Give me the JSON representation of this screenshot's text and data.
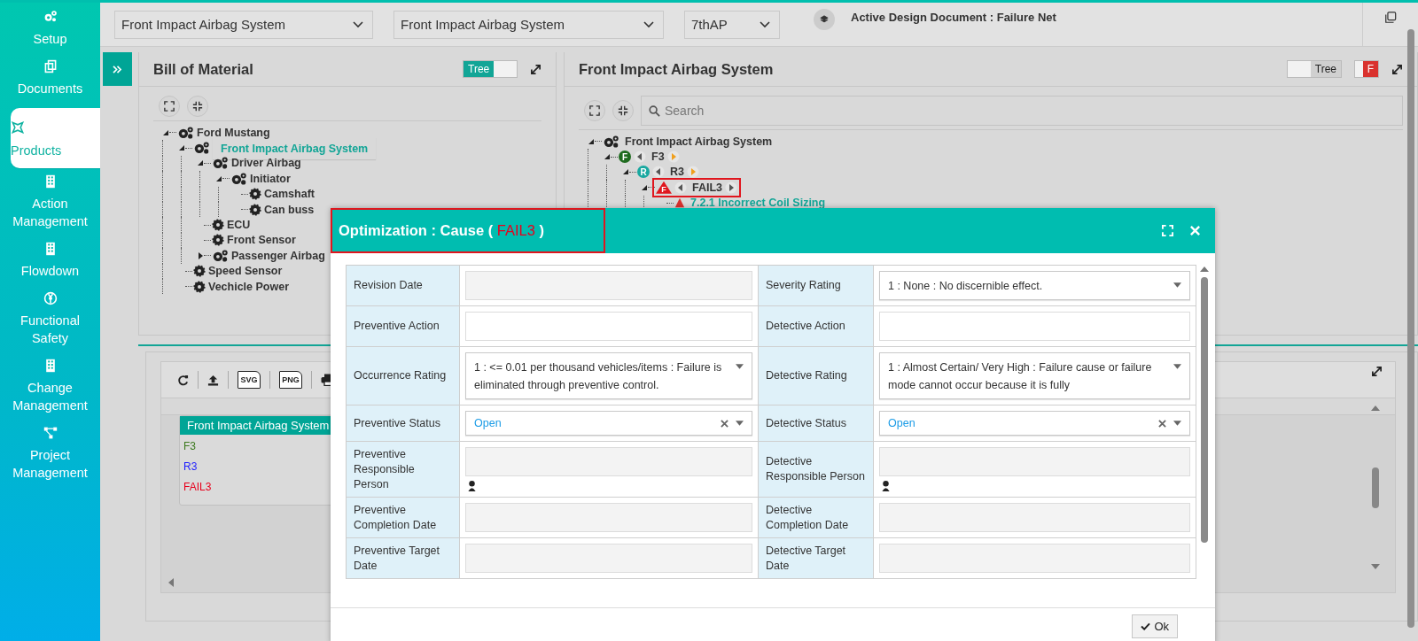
{
  "sidebar": {
    "items": [
      {
        "label": "Setup",
        "selected": false
      },
      {
        "label": "Documents",
        "selected": false
      },
      {
        "label": "Products",
        "selected": true
      },
      {
        "label": "Action Management",
        "selected": false
      },
      {
        "label": "Flowdown",
        "selected": false
      },
      {
        "label": "Functional Safety",
        "selected": false
      },
      {
        "label": "Change Management",
        "selected": false
      },
      {
        "label": "Project Management",
        "selected": false
      }
    ]
  },
  "topbar": {
    "selects": [
      "Front Impact Airbag System",
      "Front Impact Airbag System",
      "7thAP"
    ],
    "active_document": "Active Design Document : Failure Net"
  },
  "bom_panel": {
    "title": "Bill of Material",
    "toggle": {
      "label": "Tree",
      "on": true
    },
    "tree": [
      {
        "label": "Ford Mustang",
        "kind": "assembly",
        "expanded": true,
        "selected": false,
        "children": [
          {
            "label": "Front Impact Airbag System",
            "kind": "assembly",
            "expanded": true,
            "selected": true,
            "children": [
              {
                "label": "Driver Airbag",
                "kind": "assembly",
                "expanded": true,
                "selected": false,
                "children": [
                  {
                    "label": "Initiator",
                    "kind": "assembly",
                    "expanded": true,
                    "selected": false,
                    "children": [
                      {
                        "label": "Camshaft",
                        "kind": "part",
                        "selected": false
                      },
                      {
                        "label": "Can buss",
                        "kind": "part",
                        "selected": false
                      }
                    ]
                  }
                ]
              },
              {
                "label": "ECU",
                "kind": "part",
                "selected": false
              },
              {
                "label": "Front Sensor",
                "kind": "part",
                "selected": false
              },
              {
                "label": "Passenger Airbag",
                "kind": "assembly",
                "expanded": false,
                "selected": false
              }
            ]
          },
          {
            "label": "Speed Sensor",
            "kind": "part",
            "selected": false
          },
          {
            "label": "Vechicle Power",
            "kind": "part",
            "selected": false
          }
        ]
      }
    ]
  },
  "structure_panel": {
    "title": "Front Impact Airbag System",
    "tree_toggle": {
      "label": "Tree",
      "on": false
    },
    "flag_toggle": {
      "label": "F",
      "on": true
    },
    "search": {
      "placeholder": "Search"
    },
    "tree": [
      {
        "label": "Front Impact Airbag System",
        "kind": "assembly",
        "expanded": true,
        "children": [
          {
            "label": "F3",
            "kind": "function",
            "badge": "F",
            "expanded": true,
            "next_available": true,
            "children": [
              {
                "label": "R3",
                "kind": "requirement",
                "badge": "R",
                "expanded": true,
                "next_available": true,
                "children": [
                  {
                    "label": "FAIL3",
                    "kind": "failure",
                    "badge": "F",
                    "expanded": true,
                    "next_available": false,
                    "highlighted": true,
                    "children": [
                      {
                        "label": "7.2.1 Incorrect Coil Sizing",
                        "kind": "cause"
                      }
                    ]
                  }
                ]
              }
            ]
          }
        ]
      }
    ]
  },
  "report_panel": {
    "toolbar": [
      {
        "kind": "refresh"
      },
      {
        "kind": "upload"
      },
      {
        "kind": "file",
        "label": "SVG"
      },
      {
        "kind": "file",
        "label": "PNG"
      },
      {
        "kind": "print"
      }
    ],
    "card": {
      "title": "Front Impact Airbag System",
      "rows": [
        {
          "label": "F3",
          "color": "#3d7a1f"
        },
        {
          "label": "R3",
          "color": "#1f1fff"
        },
        {
          "label": "FAIL3",
          "color": "#e8001c"
        }
      ]
    }
  },
  "dialog": {
    "title": "Optimization : Cause (",
    "subject": "FAIL3",
    "title_end": ")",
    "highlighted": true,
    "rows": [
      {
        "left": {
          "label": "Revision Date",
          "kind": "date"
        },
        "right": {
          "label": "Severity Rating",
          "kind": "select",
          "value": "1 : None : No discernible effect."
        }
      },
      {
        "left": {
          "label": "Preventive Action",
          "kind": "text"
        },
        "right": {
          "label": "Detective Action",
          "kind": "text"
        }
      },
      {
        "left": {
          "label": "Occurrence Rating",
          "kind": "select",
          "value": "1 : <= 0.01 per thousand vehicles/items : Failure is eliminated through preventive control."
        },
        "right": {
          "label": "Detective Rating",
          "kind": "select",
          "value": "1 : Almost Certain/ Very High : Failure cause or failure mode cannot occur because it is fully"
        }
      },
      {
        "left": {
          "label": "Preventive Status",
          "kind": "status",
          "value": "Open"
        },
        "right": {
          "label": "Detective Status",
          "kind": "status",
          "value": "Open"
        }
      },
      {
        "left": {
          "label": "Preventive Responsible Person",
          "kind": "person"
        },
        "right": {
          "label": "Detective Responsible Person",
          "kind": "person"
        }
      },
      {
        "left": {
          "label": "Preventive Completion Date",
          "kind": "date"
        },
        "right": {
          "label": "Detective Completion Date",
          "kind": "date"
        }
      },
      {
        "left": {
          "label": "Preventive Target Date",
          "kind": "date"
        },
        "right": {
          "label": "Detective Target Date",
          "kind": "date"
        }
      }
    ],
    "ok_button": "Ok"
  }
}
